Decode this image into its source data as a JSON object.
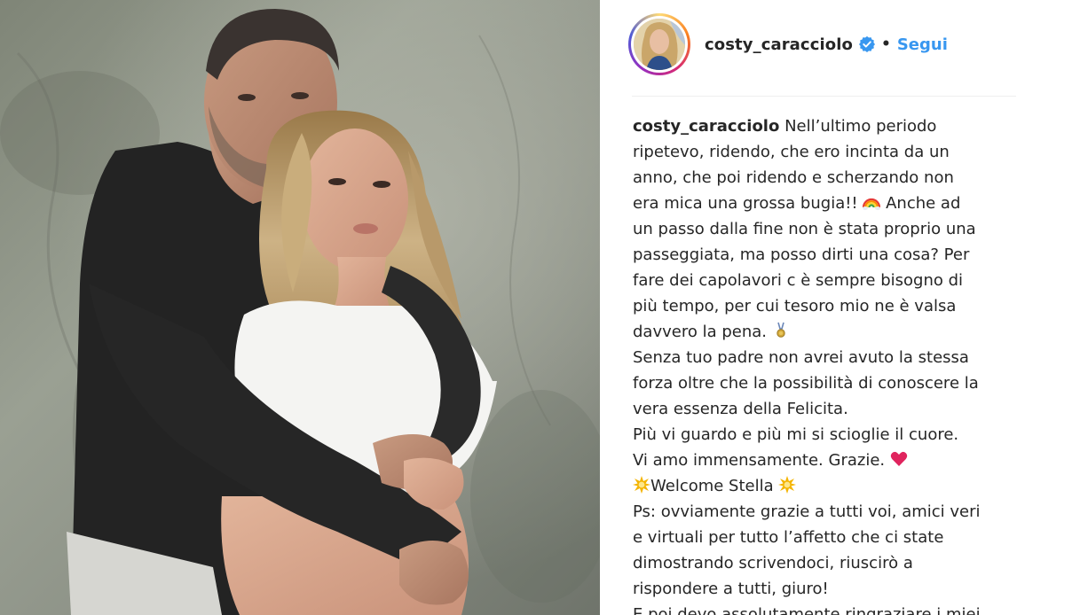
{
  "post": {
    "author": {
      "username": "costy_caracciolo",
      "verified": true,
      "follow_label": "Segui",
      "separator": "•"
    },
    "caption": {
      "lines": [
        "Nell’ultimo periodo",
        "ripetevo, ridendo, che ero incinta da un",
        "anno, che poi ridendo e scherzando non",
        "era mica una grossa bugia!! ",
        " Anche ad",
        "un passo dalla fine non è stata proprio una",
        "passeggiata, ma posso dirti una cosa? Per",
        "fare dei capolavori c è sempre bisogno di",
        "più tempo, per cui tesoro mio ne è valsa",
        "davvero la pena. ",
        "Senza tuo padre non avrei avuto la stessa",
        "forza oltre che la possibilità di conoscere la",
        "vera essenza della Felicita.",
        "Più vi guardo e più mi si scioglie il cuore.",
        "Vi amo immensamente. Grazie. ",
        "Welcome Stella ",
        "Ps: ovviamente grazie a tutti voi, amici veri",
        "e virtuali per tutto l’affetto che ci state",
        "dimostrando scrivendoci, riuscirò a",
        "rispondere a tutti, giuro!",
        "E poi devo assolutamente ringraziare i miei"
      ],
      "emojis": {
        "rainbow": "rainbow-emoji",
        "medal": "medal-emoji",
        "heart": "red-heart-emoji",
        "sparkle": "glowing-star-emoji"
      }
    },
    "colors": {
      "link_blue": "#3897f0",
      "verified_blue": "#3897f0",
      "text": "#262626",
      "divider": "#efefef",
      "heart_red": "#e0245e"
    }
  }
}
